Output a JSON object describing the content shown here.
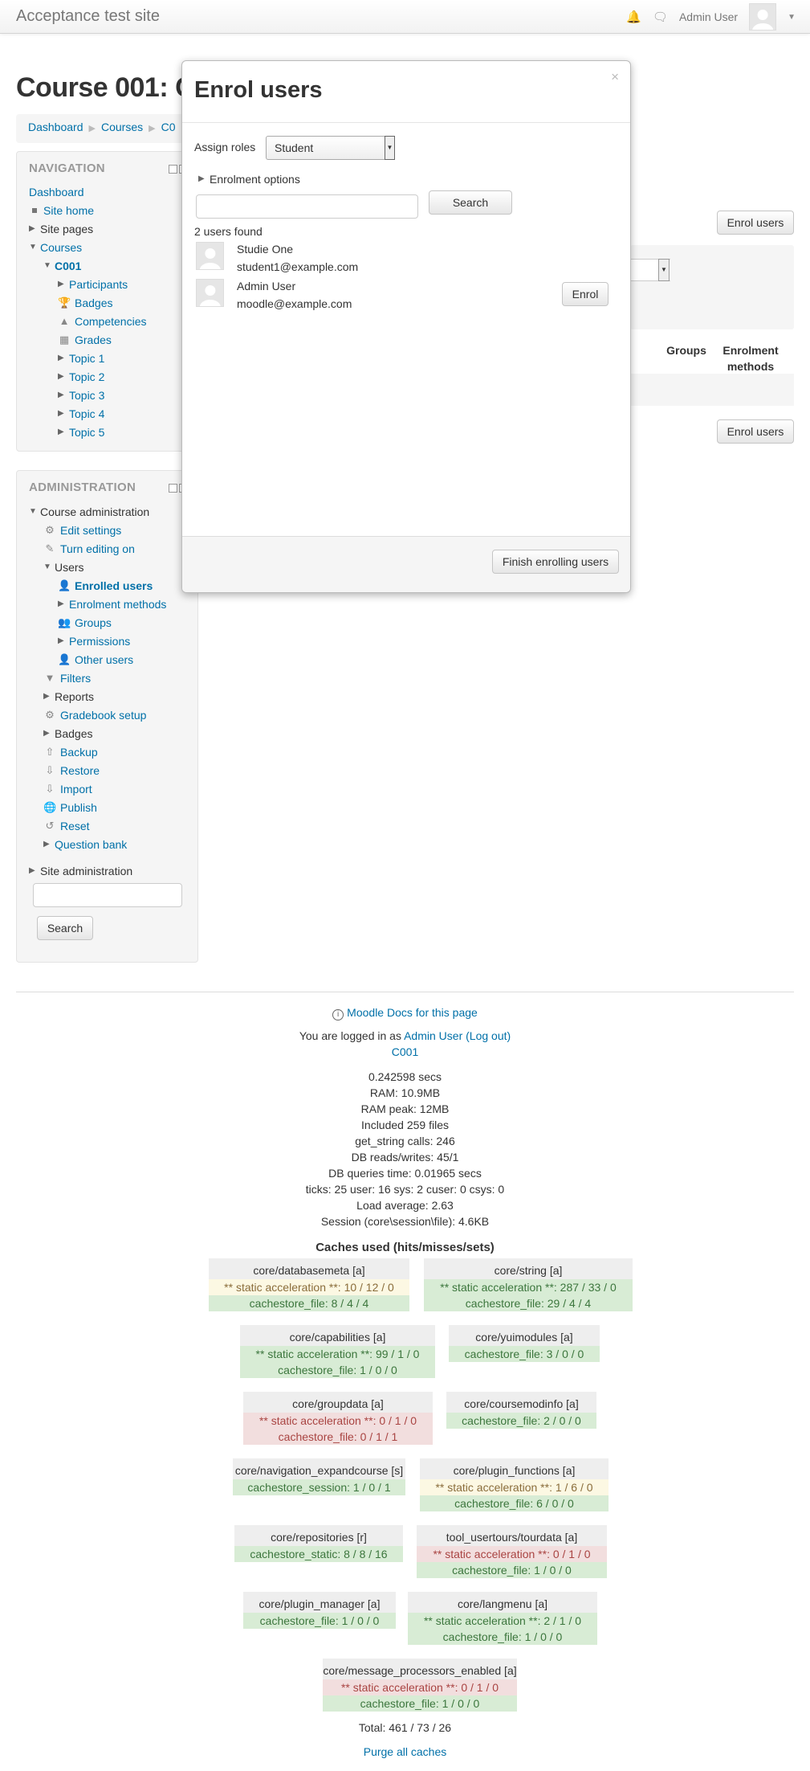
{
  "site": {
    "brand": "Acceptance test site",
    "user_name": "Admin User"
  },
  "page": {
    "title": "Course 001: C",
    "breadcrumb": [
      "Dashboard",
      "Courses",
      "C0"
    ]
  },
  "navigation": {
    "title": "NAVIGATION",
    "items": {
      "dashboard": "Dashboard",
      "site_home": "Site home",
      "site_pages": "Site pages",
      "courses": "Courses",
      "c001": "C001",
      "participants": "Participants",
      "badges": "Badges",
      "competencies": "Competencies",
      "grades": "Grades",
      "topic1": "Topic 1",
      "topic2": "Topic 2",
      "topic3": "Topic 3",
      "topic4": "Topic 4",
      "topic5": "Topic 5"
    }
  },
  "administration": {
    "title": "ADMINISTRATION",
    "items": {
      "course_admin": "Course administration",
      "edit_settings": "Edit settings",
      "turn_editing_on": "Turn editing on",
      "users": "Users",
      "enrolled_users": "Enrolled users",
      "enrolment_methods": "Enrolment methods",
      "groups": "Groups",
      "permissions": "Permissions",
      "other_users": "Other users",
      "filters": "Filters",
      "reports": "Reports",
      "gradebook_setup": "Gradebook setup",
      "badges": "Badges",
      "backup": "Backup",
      "restore": "Restore",
      "import": "Import",
      "publish": "Publish",
      "reset": "Reset",
      "question_bank": "Question bank",
      "site_admin": "Site administration"
    },
    "search_button": "Search"
  },
  "main": {
    "enrol_users_button": "Enrol users",
    "columns": {
      "groups": "Groups",
      "enrolment_methods": "Enrolment methods"
    }
  },
  "modal": {
    "title": "Enrol users",
    "close": "×",
    "assign_roles_label": "Assign roles",
    "role_value": "Student",
    "enrolment_options": "Enrolment options",
    "search_button": "Search",
    "users_found": "2 users found",
    "users": [
      {
        "name": "Studie One",
        "email": "student1@example.com"
      },
      {
        "name": "Admin User",
        "email": "moodle@example.com"
      }
    ],
    "enrol_button": "Enrol",
    "finish_button": "Finish enrolling users"
  },
  "footer": {
    "docs_link": "Moodle Docs for this page",
    "logged_in_prefix": "You are logged in as",
    "logged_in_user": "Admin User",
    "logout": "(Log out)",
    "course_link": "C001",
    "perf": [
      "0.242598 secs",
      "RAM: 10.9MB",
      "RAM peak: 12MB",
      "Included 259 files",
      "get_string calls: 246",
      "DB reads/writes: 45/1",
      "DB queries time: 0.01965 secs",
      "ticks: 25 user: 16 sys: 2 cuser: 0 csys: 0",
      "Load average: 2.63",
      "Session (core\\session\\file): 4.6KB"
    ],
    "caches_title": "Caches used (hits/misses/sets)",
    "caches": [
      {
        "name": "core/databasemeta [a]",
        "lines": [
          {
            "text": "** static acceleration **: 10 / 12 / 0",
            "status": "yellow"
          },
          {
            "text": "cachestore_file: 8 / 4 / 4",
            "status": "green"
          }
        ]
      },
      {
        "name": "core/string [a]",
        "lines": [
          {
            "text": "** static acceleration **: 287 / 33 / 0",
            "status": "green"
          },
          {
            "text": "cachestore_file: 29 / 4 / 4",
            "status": "green"
          }
        ]
      },
      {
        "name": "core/capabilities [a]",
        "lines": [
          {
            "text": "** static acceleration **: 99 / 1 / 0",
            "status": "green"
          },
          {
            "text": "cachestore_file: 1 / 0 / 0",
            "status": "green"
          }
        ]
      },
      {
        "name": "core/yuimodules [a]",
        "lines": [
          {
            "text": "cachestore_file: 3 / 0 / 0",
            "status": "green"
          }
        ]
      },
      {
        "name": "core/groupdata [a]",
        "lines": [
          {
            "text": "** static acceleration **: 0 / 1 / 0",
            "status": "red"
          },
          {
            "text": "cachestore_file: 0 / 1 / 1",
            "status": "red"
          }
        ]
      },
      {
        "name": "core/coursemodinfo [a]",
        "lines": [
          {
            "text": "cachestore_file: 2 / 0 / 0",
            "status": "green"
          }
        ]
      },
      {
        "name": "core/navigation_expandcourse [s]",
        "lines": [
          {
            "text": "cachestore_session: 1 / 0 / 1",
            "status": "green"
          }
        ]
      },
      {
        "name": "core/plugin_functions [a]",
        "lines": [
          {
            "text": "** static acceleration **: 1 / 6 / 0",
            "status": "yellow"
          },
          {
            "text": "cachestore_file: 6 / 0 / 0",
            "status": "green"
          }
        ]
      },
      {
        "name": "core/repositories [r]",
        "lines": [
          {
            "text": "cachestore_static: 8 / 8 / 16",
            "status": "green"
          }
        ]
      },
      {
        "name": "tool_usertours/tourdata [a]",
        "lines": [
          {
            "text": "** static acceleration **: 0 / 1 / 0",
            "status": "red"
          },
          {
            "text": "cachestore_file: 1 / 0 / 0",
            "status": "green"
          }
        ]
      },
      {
        "name": "core/plugin_manager [a]",
        "lines": [
          {
            "text": "cachestore_file: 1 / 0 / 0",
            "status": "green"
          }
        ]
      },
      {
        "name": "core/langmenu [a]",
        "lines": [
          {
            "text": "** static acceleration **: 2 / 1 / 0",
            "status": "green"
          },
          {
            "text": "cachestore_file: 1 / 0 / 0",
            "status": "green"
          }
        ]
      },
      {
        "name": "core/message_processors_enabled [a]",
        "lines": [
          {
            "text": "** static acceleration **: 0 / 1 / 0",
            "status": "red"
          },
          {
            "text": "cachestore_file: 1 / 0 / 0",
            "status": "green"
          }
        ]
      }
    ],
    "total": "Total: 461 / 73 / 26",
    "purge_link": "Purge all caches"
  }
}
